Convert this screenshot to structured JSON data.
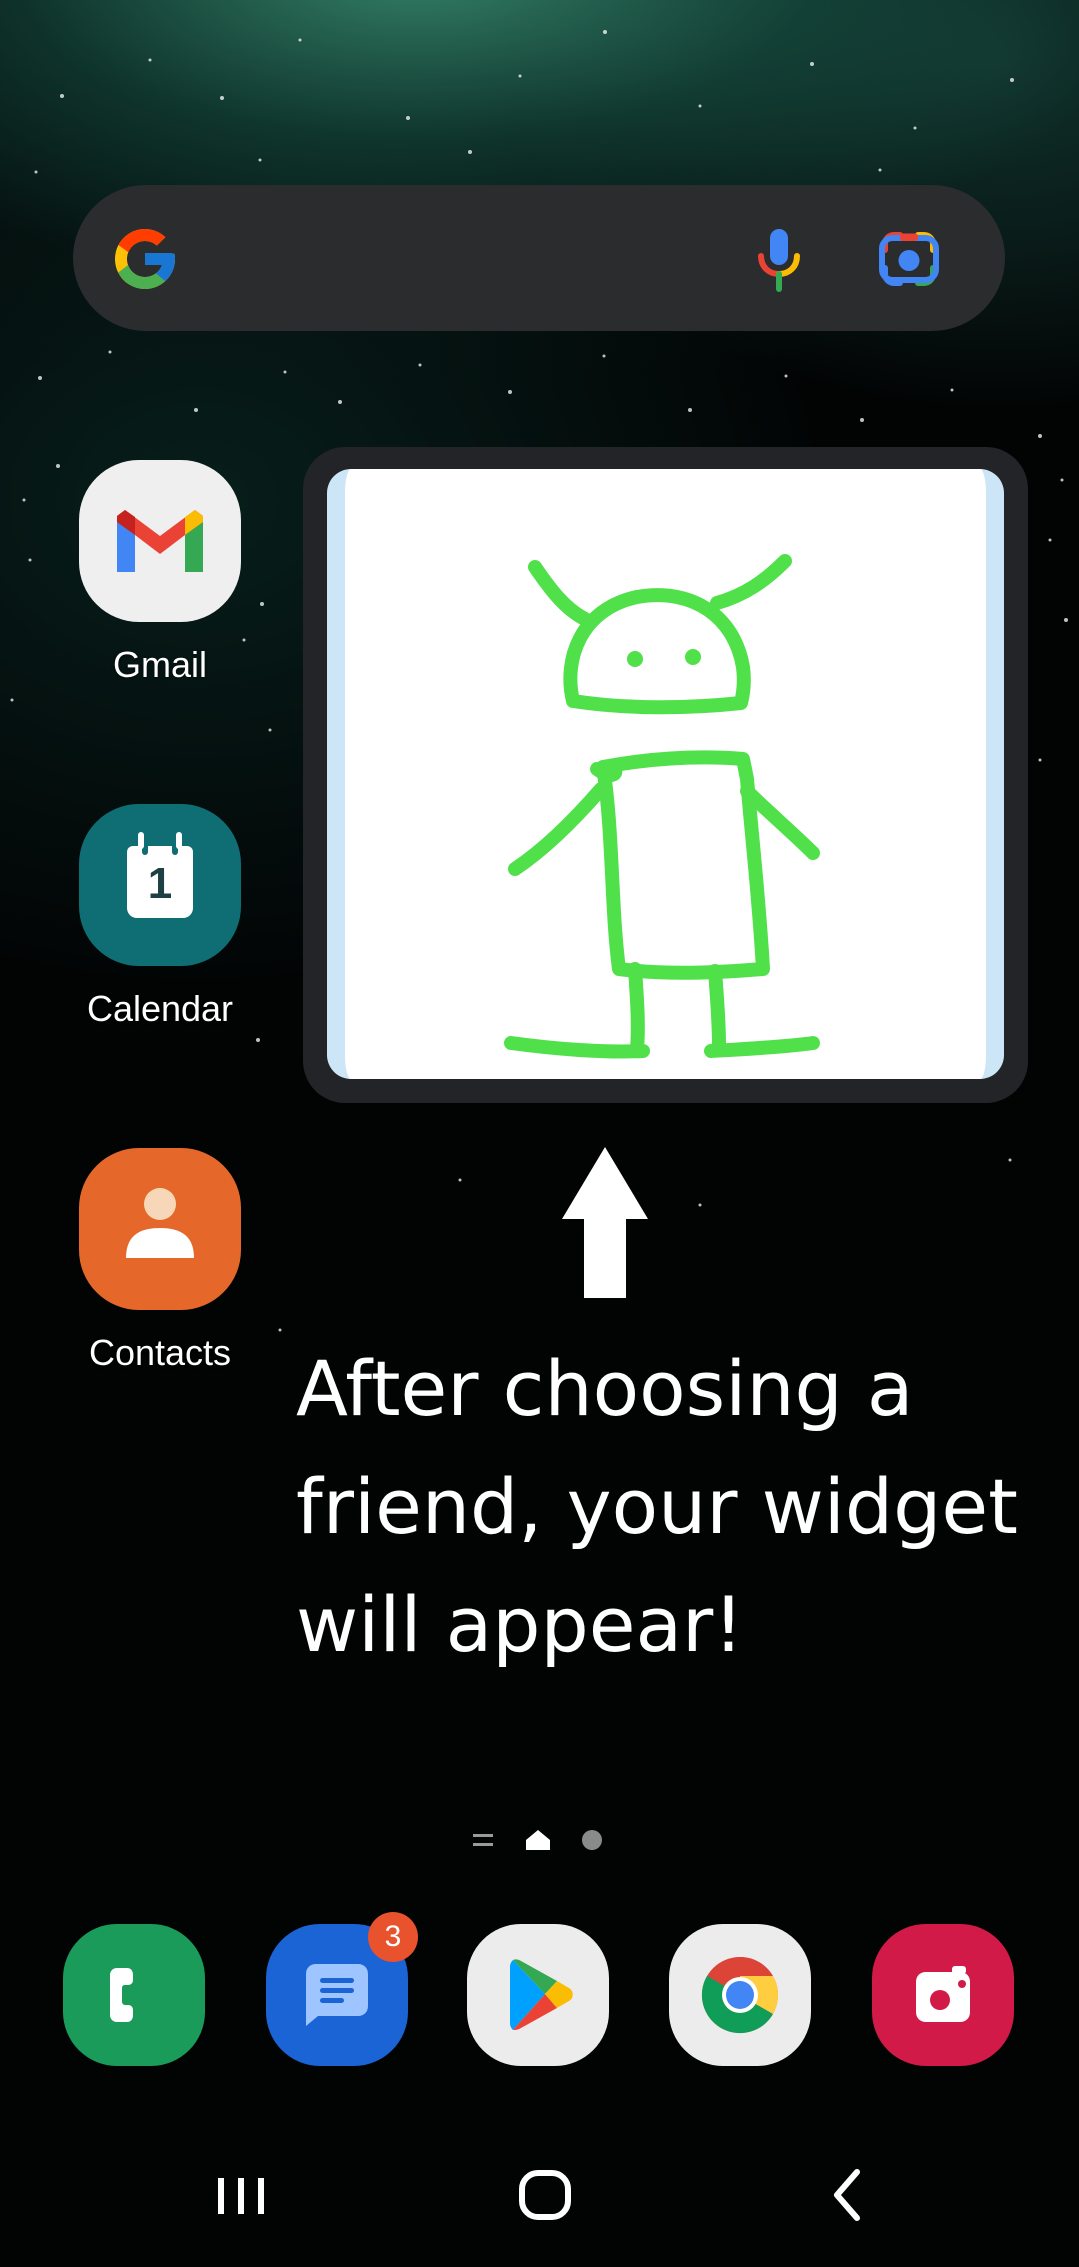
{
  "apps": {
    "gmail": {
      "label": "Gmail"
    },
    "calendar": {
      "label": "Calendar",
      "date": "1"
    },
    "contacts": {
      "label": "Contacts"
    }
  },
  "hint": {
    "line1": "After choosing a",
    "line2": "friend, your widget",
    "line3": "will appear!"
  },
  "dock": {
    "messages_badge": "3"
  },
  "icons": {
    "search": [
      "google-logo-icon",
      "microphone-icon",
      "google-lens-icon"
    ],
    "dock": [
      "phone-icon",
      "messages-icon",
      "play-store-icon",
      "chrome-icon",
      "camera-icon"
    ],
    "nav": [
      "recents-icon",
      "home-icon",
      "back-icon"
    ]
  },
  "colors": {
    "drawing_stroke": "#4fe04a",
    "widget_frame": "#232427",
    "search_bar": "#2b2c2e"
  }
}
